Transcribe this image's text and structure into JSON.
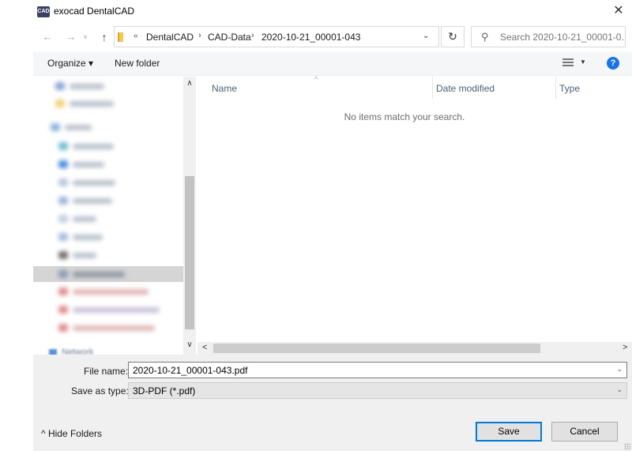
{
  "window": {
    "title": "exocad DentalCAD",
    "logo_text": "CAD",
    "close_glyph": "✕"
  },
  "address": {
    "back_glyph": "←",
    "forward_glyph": "→",
    "recent_glyph": "∨",
    "up_glyph": "↑",
    "overflow_glyph": "«",
    "crumbs": [
      "DentalCAD",
      "CAD-Data",
      "2020-10-21_00001-043"
    ],
    "separator": "›",
    "dropdown_glyph": "⌄",
    "refresh_glyph": "↻",
    "search_placeholder": "Search 2020-10-21_00001-0...",
    "search_icon": "search-icon"
  },
  "toolbar": {
    "organize_label": "Organize ▾",
    "new_folder_label": "New folder",
    "view_dd_glyph": "▼",
    "help_glyph": "?"
  },
  "navpane": {
    "up_arrow": "∧",
    "down_arrow": "∨",
    "network_label": "Network"
  },
  "filelist": {
    "columns": [
      "Name",
      "Date modified",
      "Type"
    ],
    "sort_caret": "^",
    "empty_message": "No items match your search.",
    "left_arrow": "<",
    "right_arrow": ">"
  },
  "form": {
    "file_name_label": "File name:",
    "file_name_value": "2020-10-21_00001-043.pdf",
    "save_type_label": "Save as type:",
    "save_type_value": "3D-PDF (*.pdf)",
    "dropdown_glyph": "⌄"
  },
  "footer": {
    "hide_folders_label": "^  Hide Folders",
    "save_label": "Save",
    "cancel_label": "Cancel"
  },
  "colors": {
    "accent": "#0078d7",
    "help_blue": "#1a73e8",
    "column_header_text": "#4c607a"
  }
}
